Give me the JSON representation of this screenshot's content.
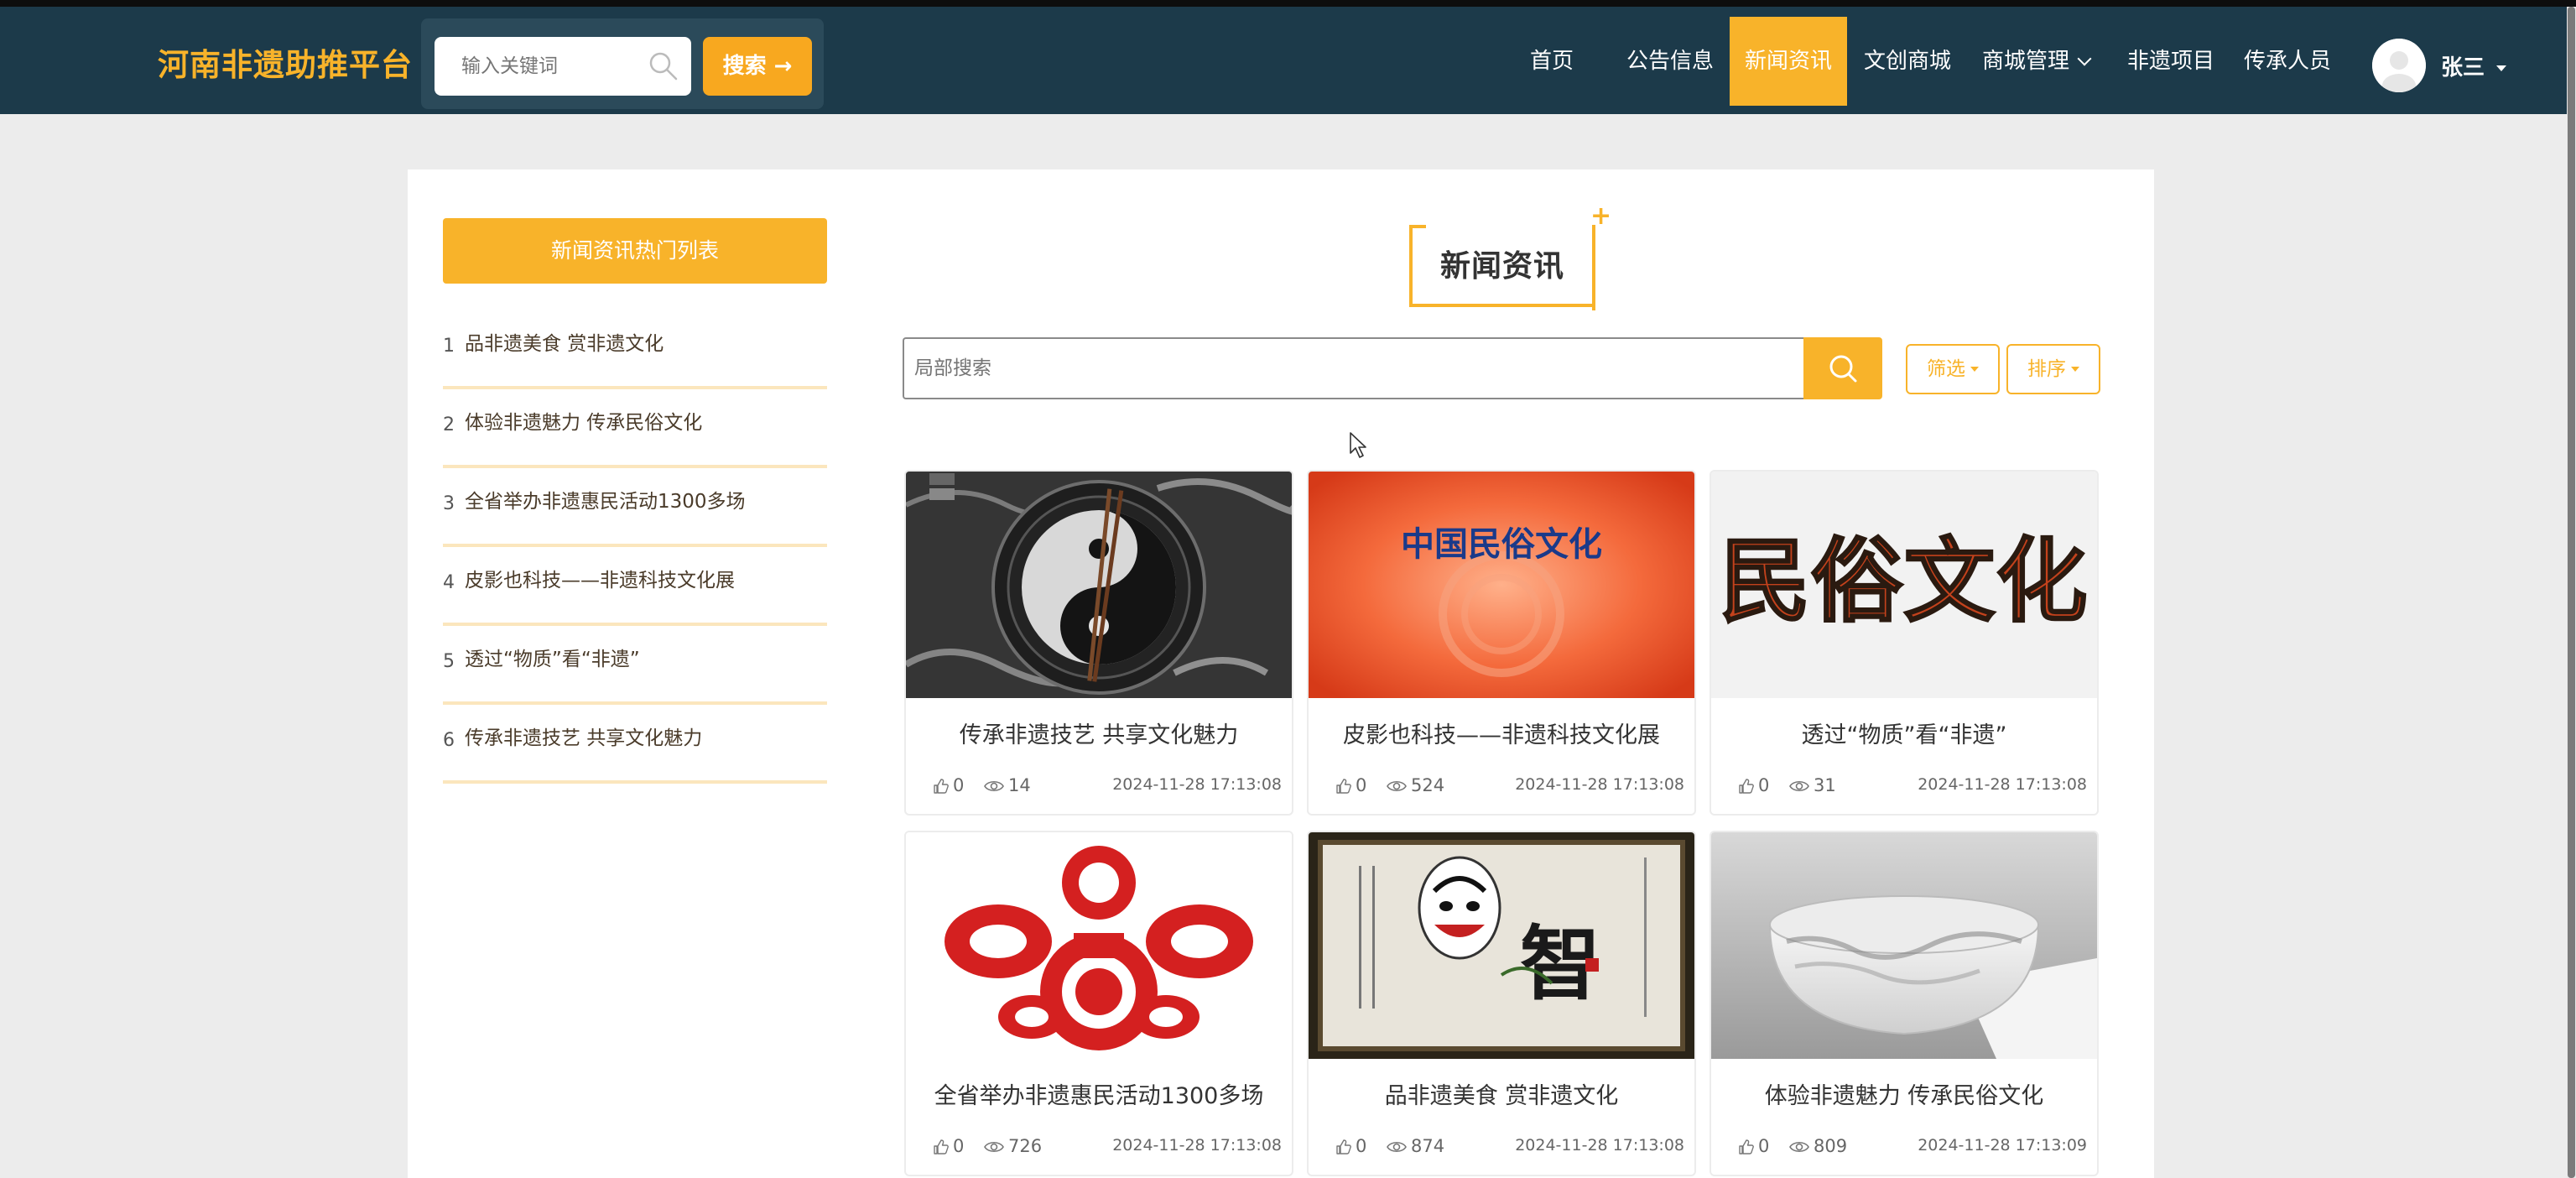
{
  "header": {
    "brand": "河南非遗助推平台",
    "search_placeholder": "输入关键词",
    "search_button": "搜索 →",
    "nav": [
      {
        "label": "首页"
      },
      {
        "label": "公告信息"
      },
      {
        "label": "新闻资讯",
        "active": true
      },
      {
        "label": "文创商城"
      },
      {
        "label": "商城管理",
        "dropdown": true
      },
      {
        "label": "非遗项目"
      },
      {
        "label": "传承人员"
      }
    ],
    "user_name": "张三"
  },
  "sidebar": {
    "title": "新闻资讯热门列表",
    "items": [
      {
        "num": "1",
        "text": "品非遗美食 赏非遗文化"
      },
      {
        "num": "2",
        "text": "体验非遗魅力 传承民俗文化"
      },
      {
        "num": "3",
        "text": "全省举办非遗惠民活动1300多场"
      },
      {
        "num": "4",
        "text": "皮影也科技——非遗科技文化展"
      },
      {
        "num": "5",
        "text": "透过“物质”看“非遗”"
      },
      {
        "num": "6",
        "text": "传承非遗技艺 共享文化魅力"
      }
    ]
  },
  "main": {
    "heading": "新闻资讯",
    "heading_plus": "+",
    "local_search_placeholder": "局部搜索",
    "filter_label": "筛选",
    "sort_label": "排序",
    "cards": [
      {
        "title": "传承非遗技艺 共享文化魅力",
        "likes": "0",
        "views": "14",
        "time": "2024-11-28 17:13:08",
        "image": "taiji-rice-plate"
      },
      {
        "title": "皮影也科技——非遗科技文化展",
        "likes": "0",
        "views": "524",
        "time": "2024-11-28 17:13:08",
        "image": "folk-culture-red-banner",
        "image_text": "中国民俗文化"
      },
      {
        "title": "透过“物质”看“非遗”",
        "likes": "0",
        "views": "31",
        "time": "2024-11-28 17:13:08",
        "image": "folk-culture-calligraphy",
        "image_text": "民俗文化"
      },
      {
        "title": "全省举办非遗惠民活动1300多场",
        "likes": "0",
        "views": "726",
        "time": "2024-11-28 17:13:08",
        "image": "red-paper-cut"
      },
      {
        "title": "品非遗美食 赏非遗文化",
        "likes": "0",
        "views": "874",
        "time": "2024-11-28 17:13:08",
        "image": "opera-mask-painting",
        "image_text": "智"
      },
      {
        "title": "体验非遗魅力 传承民俗文化",
        "likes": "0",
        "views": "809",
        "time": "2024-11-28 17:13:09",
        "image": "porcelain-bowl"
      }
    ]
  },
  "colors": {
    "header_bg": "#1c3a4a",
    "accent": "#f8b32a",
    "brand_text": "#f8b32a",
    "divider": "#fbe6bd"
  }
}
